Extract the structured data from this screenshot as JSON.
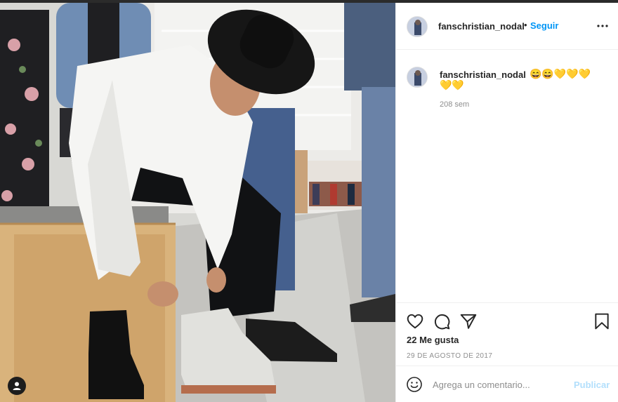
{
  "post": {
    "username": "fanschristian_nodal",
    "follow_label": "Seguir",
    "separator": "•",
    "more_label": "Más opciones"
  },
  "caption": {
    "username": "fanschristian_nodal",
    "text_line1": "😄😄💛💛💛",
    "text_line2": "💛💛",
    "time_ago": "208 sem"
  },
  "actions": {
    "likes": "22 Me gusta",
    "date": "29 DE AGOSTO DE 2017"
  },
  "comment": {
    "placeholder": "Agrega un comentario...",
    "publish_label": "Publicar"
  },
  "icons": {
    "like": "heart-icon",
    "comment": "comment-bubble-icon",
    "share": "paper-plane-icon",
    "save": "bookmark-icon",
    "more": "ellipsis-icon",
    "emoji": "smiley-icon",
    "user_tag": "person-icon"
  },
  "colors": {
    "follow_blue": "#0095f6",
    "publish_disabled": "#b2dffc",
    "meta_grey": "#8e8e8e"
  }
}
